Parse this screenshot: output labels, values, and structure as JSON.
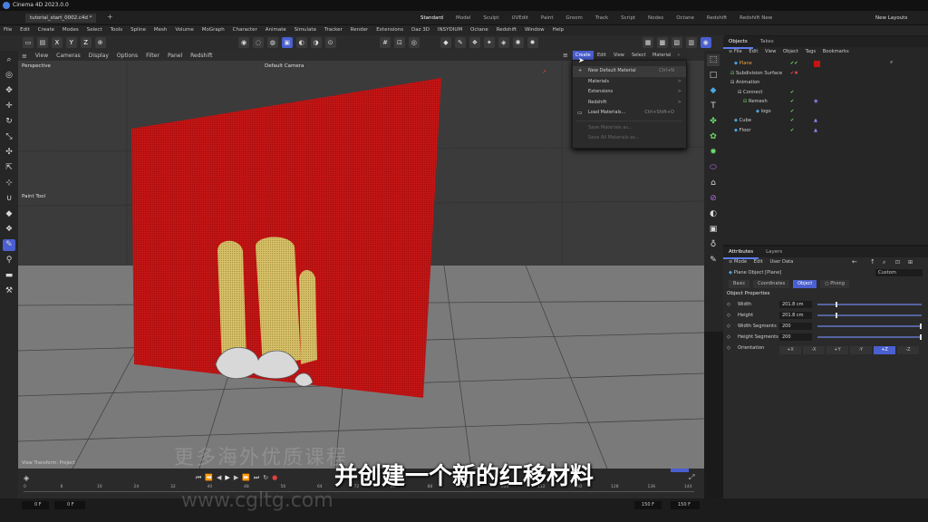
{
  "app": {
    "title": "Cinema 4D 2023.0.0",
    "doc_tab": "tutorial_start_0002.c4d *",
    "new_tab": "+"
  },
  "layouts": {
    "tabs": [
      "Standard",
      "Model",
      "Sculpt",
      "UVEdit",
      "Paint",
      "Groom",
      "Track",
      "Script",
      "Nodes",
      "Octane",
      "Redshift",
      "Redshift New"
    ],
    "active": "Standard",
    "new_layouts": "New Layouts"
  },
  "menu": [
    "File",
    "Edit",
    "Create",
    "Modes",
    "Select",
    "Tools",
    "Spline",
    "Mesh",
    "Volume",
    "MoGraph",
    "Character",
    "Animate",
    "Simulate",
    "Tracker",
    "Render",
    "Extensions",
    "Daz 3D",
    "INSYDIUM",
    "Octane",
    "Redshift",
    "Window",
    "Help"
  ],
  "toolbar": {
    "axes": [
      "X",
      "Y",
      "Z"
    ]
  },
  "viewport": {
    "menu": [
      "View",
      "Cameras",
      "Display",
      "Options",
      "Filter",
      "Panel",
      "Redshift"
    ],
    "label": "Perspective",
    "camera": "Default Camera",
    "tool_label": "Paint Tool",
    "transform_label": "View Transform: Project"
  },
  "material_menu": {
    "bar": [
      "Create",
      "Edit",
      "View",
      "Select",
      "Material"
    ],
    "items": [
      {
        "label": "New Default Material",
        "shortcut": "Ctrl+N",
        "icon": "+"
      },
      {
        "label": "Materials",
        "arrow": ">"
      },
      {
        "label": "Extensions",
        "arrow": ">"
      },
      {
        "label": "Redshift",
        "arrow": ">"
      },
      {
        "label": "Load Materials...",
        "shortcut": "Ctrl+Shift+O"
      },
      {
        "label": "Save Materials as..."
      },
      {
        "label": "Save All Materials as..."
      }
    ]
  },
  "objects_panel": {
    "tabs": [
      "Objects",
      "Takes"
    ],
    "menu": [
      "File",
      "Edit",
      "View",
      "Object",
      "Tags",
      "Bookmarks"
    ],
    "items": [
      "Plane",
      "Subdivision Surface",
      "Animation",
      "Connect",
      "Remesh",
      "logo",
      "Cube",
      "Floor"
    ]
  },
  "attributes": {
    "tabs": [
      "Attributes",
      "Layers"
    ],
    "menu": [
      "Mode",
      "Edit",
      "User Data"
    ],
    "object": "Plane Object [Plane]",
    "preset": "Custom",
    "subtabs": [
      "Basic",
      "Coordinates",
      "Object",
      "Phong"
    ],
    "active_subtab": "Object",
    "section": "Object Properties",
    "rows": [
      {
        "label": "Width",
        "value": "201.8 cm",
        "level": 0.18
      },
      {
        "label": "Height",
        "value": "201.8 cm",
        "level": 0.18
      },
      {
        "label": "Width Segments",
        "value": "200",
        "level": 1.0
      },
      {
        "label": "Height Segments",
        "value": "200",
        "level": 1.0
      }
    ],
    "orientation_label": "Orientation",
    "orientation": [
      "+X",
      "-X",
      "+Y",
      "-Y",
      "+Z",
      "-Z"
    ],
    "orientation_active": "+Z"
  },
  "timeline": {
    "ticks": [
      "0",
      "8",
      "16",
      "24",
      "32",
      "40",
      "48",
      "56",
      "64",
      "72",
      "80",
      "88",
      "96",
      "104",
      "112",
      "120",
      "128",
      "136",
      "144"
    ],
    "start": "0 F",
    "min": "0 F",
    "max": "150 F",
    "end": "150 F"
  },
  "subtitle": "并创建一个新的红移材料",
  "watermark": {
    "cn": "更多海外优质课程",
    "url": "www.cgltg.com"
  },
  "colors": {
    "accent": "#5b7cf0",
    "plane": "#c41515",
    "mesh": "#d9c36a"
  }
}
